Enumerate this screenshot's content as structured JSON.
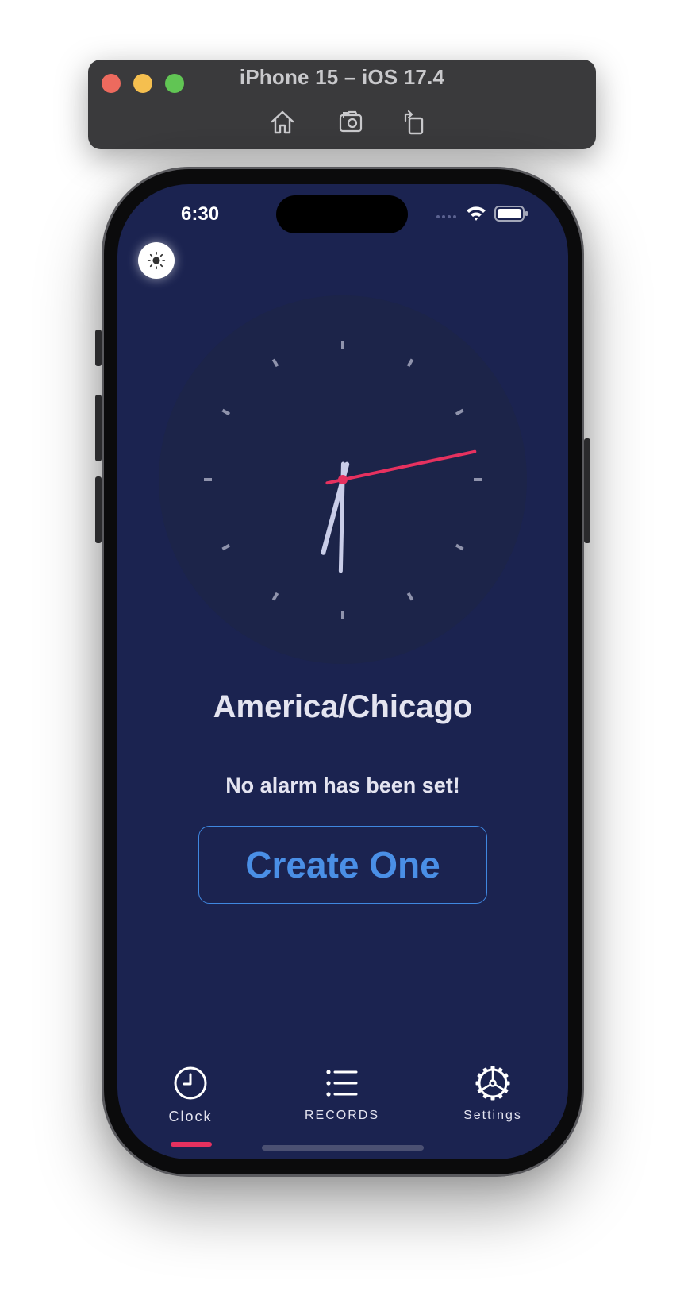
{
  "simulator": {
    "title": "iPhone 15 – iOS 17.4",
    "toolbar": [
      "home-icon",
      "screenshot-icon",
      "rotate-icon"
    ]
  },
  "status_bar": {
    "time": "6:30"
  },
  "clock": {
    "hour": 6,
    "minute": 30,
    "second": 13,
    "hand_color": "#c9cde8",
    "second_hand_color": "#e6315f",
    "face_color": "#1c2449"
  },
  "main": {
    "timezone": "America/Chicago",
    "alarm_message": "No alarm has been set!",
    "create_button": "Create One"
  },
  "tabs": [
    {
      "label": "Clock",
      "icon": "clock-icon",
      "active": true
    },
    {
      "label": "RECORDS",
      "icon": "list-icon",
      "active": false
    },
    {
      "label": "Settings",
      "icon": "gear-icon",
      "active": false
    }
  ],
  "colors": {
    "background": "#1b2350",
    "accent": "#e6315f",
    "button": "#4a8fe6"
  }
}
